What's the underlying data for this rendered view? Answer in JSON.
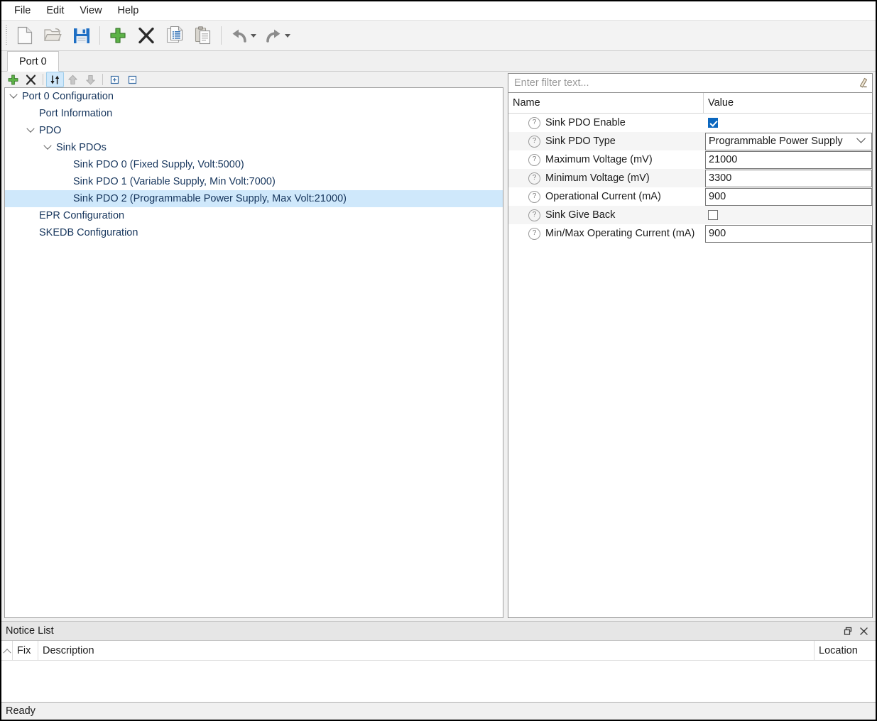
{
  "menubar": {
    "items": [
      {
        "label": "File",
        "name": "menu-file"
      },
      {
        "label": "Edit",
        "name": "menu-edit"
      },
      {
        "label": "View",
        "name": "menu-view"
      },
      {
        "label": "Help",
        "name": "menu-help"
      }
    ]
  },
  "toolbar": {
    "buttons": [
      {
        "icon": "new-file-icon",
        "label": "New"
      },
      {
        "icon": "open-folder-icon",
        "label": "Open"
      },
      {
        "icon": "save-icon",
        "label": "Save"
      },
      {
        "icon": "add-plus-icon",
        "label": "Add"
      },
      {
        "icon": "delete-x-icon",
        "label": "Delete"
      },
      {
        "icon": "copy-icon",
        "label": "Copy"
      },
      {
        "icon": "paste-icon",
        "label": "Paste"
      },
      {
        "icon": "undo-icon",
        "label": "Undo"
      },
      {
        "icon": "redo-icon",
        "label": "Redo"
      }
    ]
  },
  "tabs": [
    {
      "label": "Port 0",
      "active": true
    }
  ],
  "tree_toolbar": {
    "buttons": [
      {
        "icon": "add-plus-icon",
        "label": "Add"
      },
      {
        "icon": "delete-x-icon",
        "label": "Remove"
      },
      {
        "icon": "sort-updown-icon",
        "label": "Sort",
        "active": true
      },
      {
        "icon": "move-up-icon",
        "label": "Move Up",
        "disabled": true
      },
      {
        "icon": "move-down-icon",
        "label": "Move Down",
        "disabled": true
      },
      {
        "icon": "expand-all-icon",
        "label": "Expand All"
      },
      {
        "icon": "collapse-all-icon",
        "label": "Collapse All"
      }
    ]
  },
  "tree": {
    "nodes": [
      {
        "label": "Port 0 Configuration",
        "depth": 0,
        "expander": "expanded",
        "selected": false
      },
      {
        "label": "Port Information",
        "depth": 1,
        "expander": "none",
        "selected": false
      },
      {
        "label": "PDO",
        "depth": 1,
        "expander": "expanded",
        "selected": false
      },
      {
        "label": "Sink PDOs",
        "depth": 2,
        "expander": "expanded",
        "selected": false
      },
      {
        "label": "Sink PDO 0 (Fixed Supply, Volt:5000)",
        "depth": 3,
        "expander": "none",
        "selected": false
      },
      {
        "label": "Sink PDO 1 (Variable Supply, Min Volt:7000)",
        "depth": 3,
        "expander": "none",
        "selected": false
      },
      {
        "label": "Sink PDO 2 (Programmable Power Supply, Max Volt:21000)",
        "depth": 3,
        "expander": "none",
        "selected": true
      },
      {
        "label": "EPR Configuration",
        "depth": 1,
        "expander": "none",
        "selected": false
      },
      {
        "label": "SKEDB Configuration",
        "depth": 1,
        "expander": "none",
        "selected": false
      }
    ]
  },
  "filter": {
    "placeholder": "Enter filter text...",
    "value": "",
    "clear_icon": "eraser-icon"
  },
  "properties": {
    "headers": {
      "name": "Name",
      "value": "Value"
    },
    "rows": [
      {
        "name": "Sink PDO Enable",
        "type": "checkbox",
        "value": "true",
        "alt": false
      },
      {
        "name": "Sink PDO Type",
        "type": "combobox",
        "value": "Programmable Power Supply",
        "alt": true
      },
      {
        "name": "Maximum Voltage (mV)",
        "type": "text",
        "value": "21000",
        "alt": false
      },
      {
        "name": "Minimum Voltage (mV)",
        "type": "text",
        "value": "3300",
        "alt": true
      },
      {
        "name": "Operational Current (mA)",
        "type": "text",
        "value": "900",
        "alt": false
      },
      {
        "name": "Sink Give Back",
        "type": "checkbox",
        "value": "false",
        "alt": true
      },
      {
        "name": "Min/Max Operating Current (mA)",
        "type": "text",
        "value": "900",
        "alt": false
      }
    ]
  },
  "notice": {
    "title": "Notice List",
    "restore_icon": "restore-window-icon",
    "close_icon": "close-icon",
    "columns": {
      "fix": "Fix",
      "description": "Description",
      "location": "Location"
    },
    "rows": []
  },
  "status": {
    "text": "Ready"
  },
  "colors": {
    "selection": "#cfe8fb",
    "checkbox_checked": "#0b67bf",
    "tree_text": "#17365d",
    "toolbar_bg": "#f3f3f3"
  }
}
